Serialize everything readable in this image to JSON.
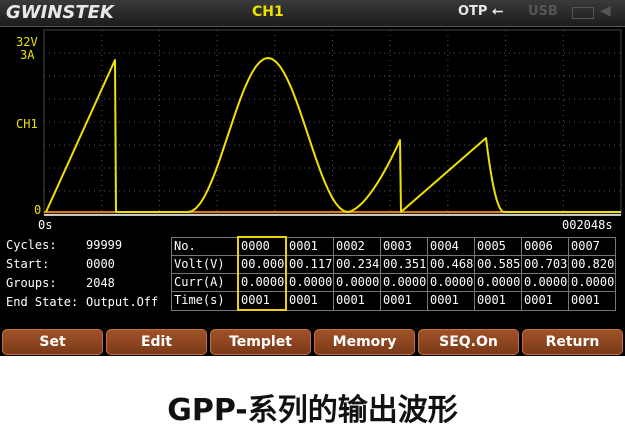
{
  "header": {
    "brand": "GWINSTEK",
    "channel": "CH1",
    "otp": "OTP",
    "usb_symbol": "⭠",
    "usb": "USB",
    "speaker": "◀"
  },
  "plot": {
    "y_labels": {
      "top_voltage": "32V",
      "top_current": "3A",
      "mid": "CH1",
      "zero": "0"
    },
    "x_labels": {
      "start": "0s",
      "end": "002048s"
    },
    "colors": {
      "trace": "#f0e000",
      "baseline": "#e07800",
      "grid": "#555555"
    }
  },
  "info": {
    "rows": [
      {
        "label": "Cycles:",
        "value": "99999"
      },
      {
        "label": "Start:",
        "value": "0000"
      },
      {
        "label": "Groups:",
        "value": "2048"
      },
      {
        "label": "End State:",
        "value": "Output.Off"
      }
    ]
  },
  "table": {
    "row_headers": [
      "No.",
      "Volt(V)",
      "Curr(A)",
      "Time(s)"
    ],
    "no": [
      "0000",
      "0001",
      "0002",
      "0003",
      "0004",
      "0005",
      "0006",
      "0007"
    ],
    "volt": [
      "00.000",
      "00.117",
      "00.234",
      "00.351",
      "00.468",
      "00.585",
      "00.703",
      "00.820"
    ],
    "curr": [
      "0.0000",
      "0.0000",
      "0.0000",
      "0.0000",
      "0.0000",
      "0.0000",
      "0.0000",
      "0.0000"
    ],
    "time": [
      "0001",
      "0001",
      "0001",
      "0001",
      "0001",
      "0001",
      "0001",
      "0001"
    ],
    "selected_column": "0000"
  },
  "softkeys": [
    "Set",
    "Edit",
    "Templet",
    "Memory",
    "SEQ.On",
    "Return"
  ],
  "caption": "GPP-系列的输出波形"
}
